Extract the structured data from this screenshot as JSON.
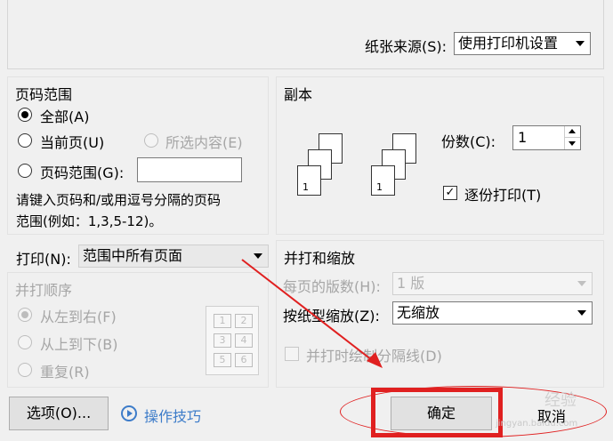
{
  "paper_source": {
    "label": "纸张来源(S):",
    "value": "使用打印机设置"
  },
  "page_range": {
    "title": "页码范围",
    "all": "全部(A)",
    "current": "当前页(U)",
    "selection": "所选内容(E)",
    "pages": "页码范围(G):",
    "pages_value": "",
    "hint_line1": "请键入页码和/或用逗号分隔的页码",
    "hint_line2": "范围(例如：1,3,5-12)。"
  },
  "copies": {
    "title": "副本",
    "count_label": "份数(C):",
    "count_value": "1",
    "collate_label": "逐份打印(T)",
    "collate_checked": "✓"
  },
  "print": {
    "label": "打印(N):",
    "value": "范围中所有页面"
  },
  "print_order": {
    "title": "并打顺序",
    "ltr": "从左到右(F)",
    "ttb": "从上到下(B)",
    "repeat": "重复(R)",
    "grid": [
      "1",
      "2",
      "3",
      "4",
      "5",
      "6"
    ]
  },
  "zoom": {
    "title": "并打和缩放",
    "pages_per_sheet_label": "每页的版数(H):",
    "pages_per_sheet_value": "1 版",
    "scale_label": "按纸型缩放(Z):",
    "scale_value": "无缩放",
    "draw_lines_label": "并打时绘制分隔线(D)"
  },
  "footer": {
    "options": "选项(O)...",
    "tips": "操作技巧",
    "ok": "确定",
    "cancel": "取消"
  },
  "page_icons": [
    "1",
    "2",
    "3"
  ],
  "annotation": {
    "color": "#e02020"
  },
  "watermark": {
    "text": "经验",
    "sub": "jingyan.baidu.com"
  }
}
